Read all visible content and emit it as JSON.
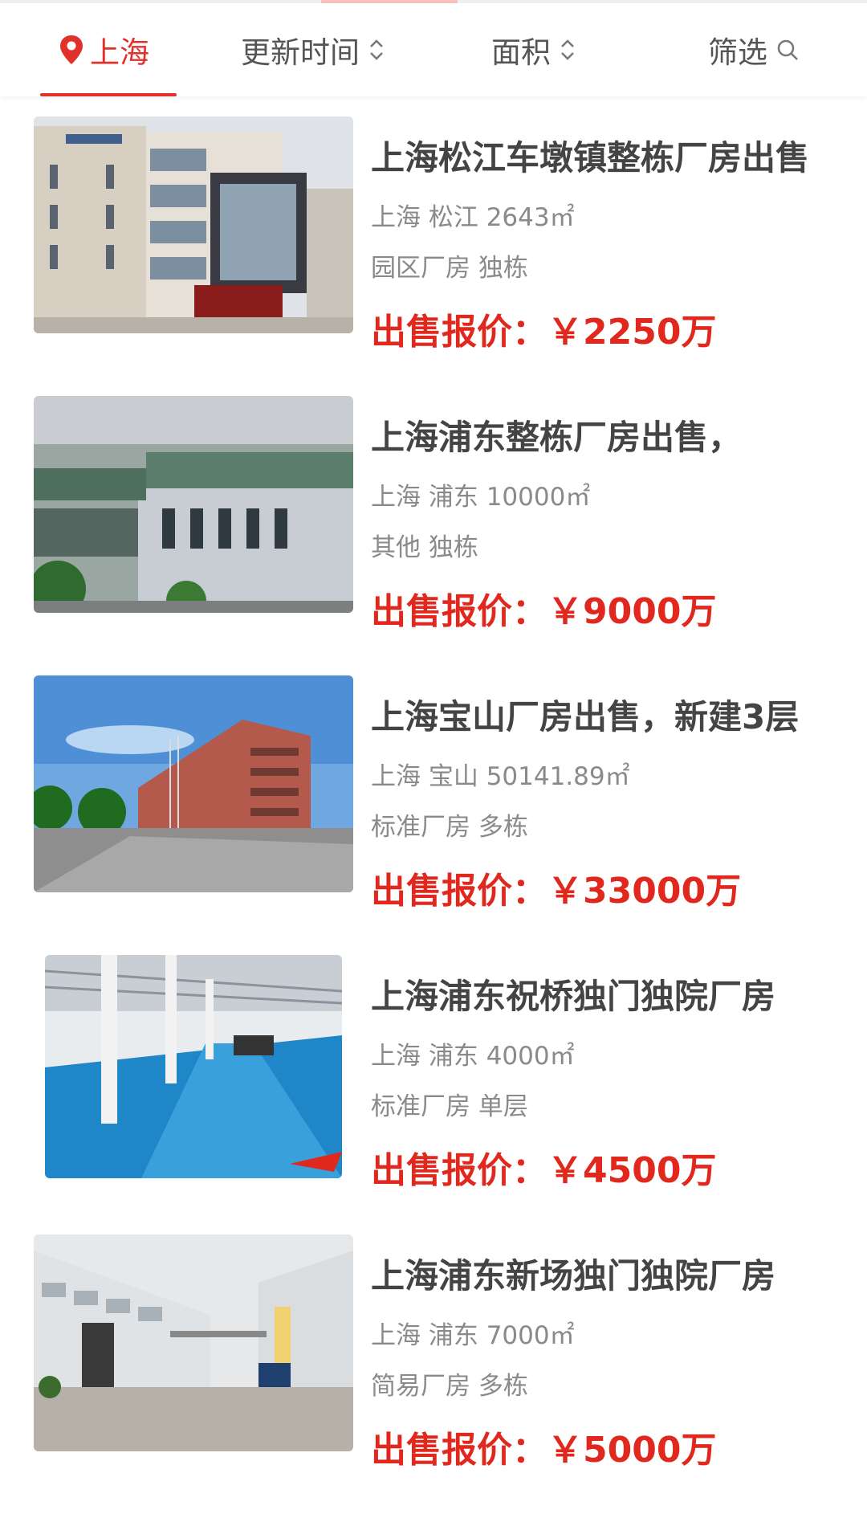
{
  "filters": {
    "city": "上海",
    "sort_time": "更新时间",
    "area": "面积",
    "filter": "筛选"
  },
  "colors": {
    "accent": "#e0312b",
    "price": "#e0281e"
  },
  "listings": [
    {
      "title": "上海松江车墩镇整栋厂房出售",
      "location": "上海 松江 2643㎡",
      "tags": "园区厂房 独栋",
      "price_label": "出售报价：",
      "price": "￥2250万"
    },
    {
      "title": "上海浦东整栋厂房出售，",
      "location": "上海 浦东 10000㎡",
      "tags": "其他 独栋",
      "price_label": "出售报价：",
      "price": "￥9000万"
    },
    {
      "title": "上海宝山厂房出售，新建3层",
      "location": "上海 宝山 50141.89㎡",
      "tags": "标准厂房 多栋",
      "price_label": "出售报价：",
      "price": "￥33000万"
    },
    {
      "title": "上海浦东祝桥独门独院厂房",
      "location": "上海 浦东 4000㎡",
      "tags": "标准厂房 单层",
      "price_label": "出售报价：",
      "price": "￥4500万"
    },
    {
      "title": "上海浦东新场独门独院厂房",
      "location": "上海 浦东 7000㎡",
      "tags": "简易厂房 多栋",
      "price_label": "出售报价：",
      "price": "￥5000万"
    }
  ]
}
